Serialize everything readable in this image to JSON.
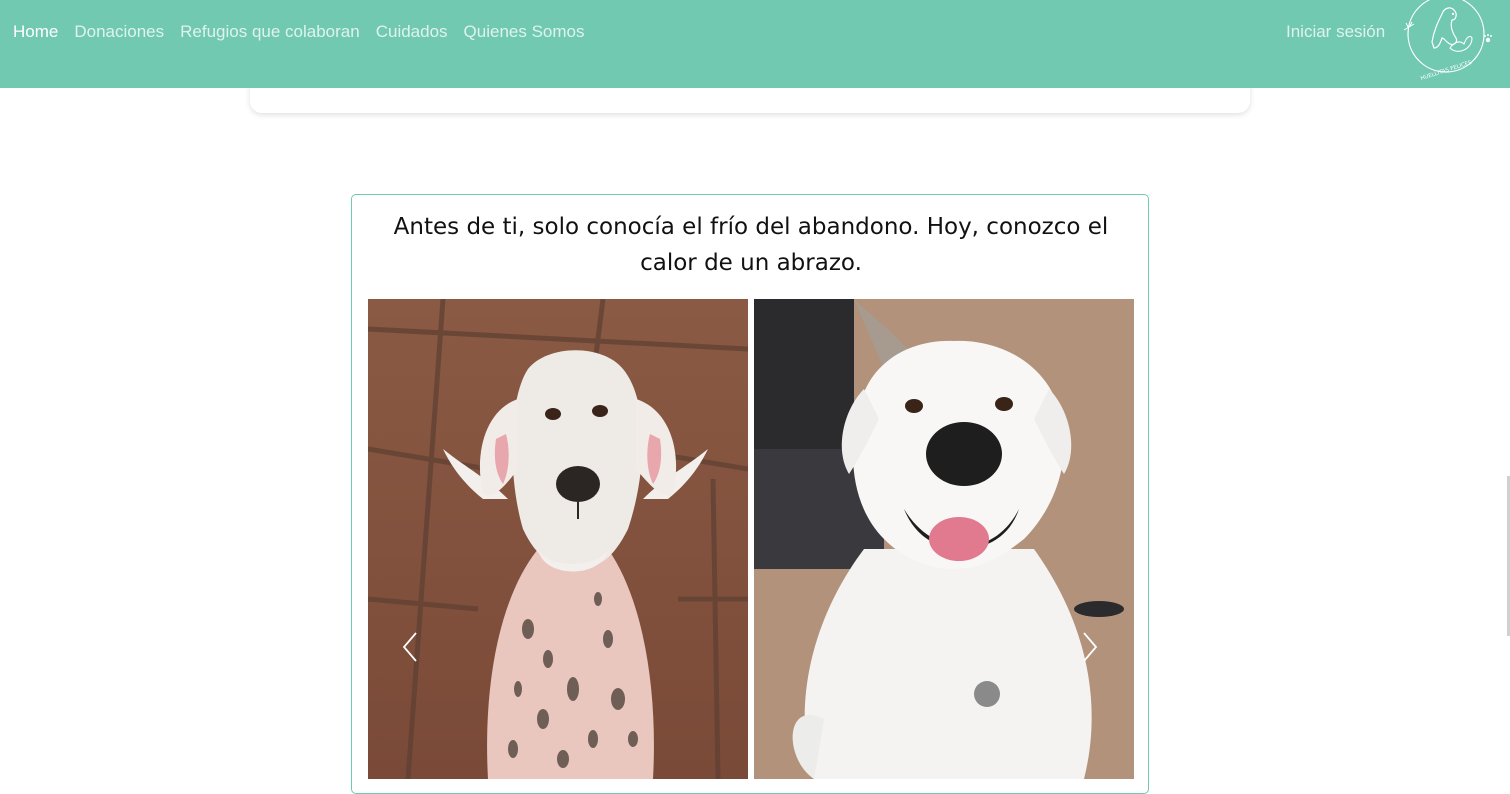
{
  "nav": {
    "links": [
      "Home",
      "Donaciones",
      "Refugios que colaboran",
      "Cuidados",
      "Quienes Somos"
    ],
    "active_index": 0,
    "login_label": "Iniciar sesión",
    "logo_text": "HUELLITAS FELICES"
  },
  "story": {
    "quote": "Antes de ti, solo conocía el frío del abandono. Hoy, conozco el calor de un abrazo.",
    "images": [
      {
        "icon": "dog-before-photo",
        "description_kind": "before"
      },
      {
        "icon": "dog-after-photo",
        "description_kind": "after"
      }
    ],
    "prev_icon": "chevron-left-icon",
    "next_icon": "chevron-right-icon"
  },
  "colors": {
    "nav_bg": "#70c9b0",
    "card_border": "#70c9b0"
  }
}
